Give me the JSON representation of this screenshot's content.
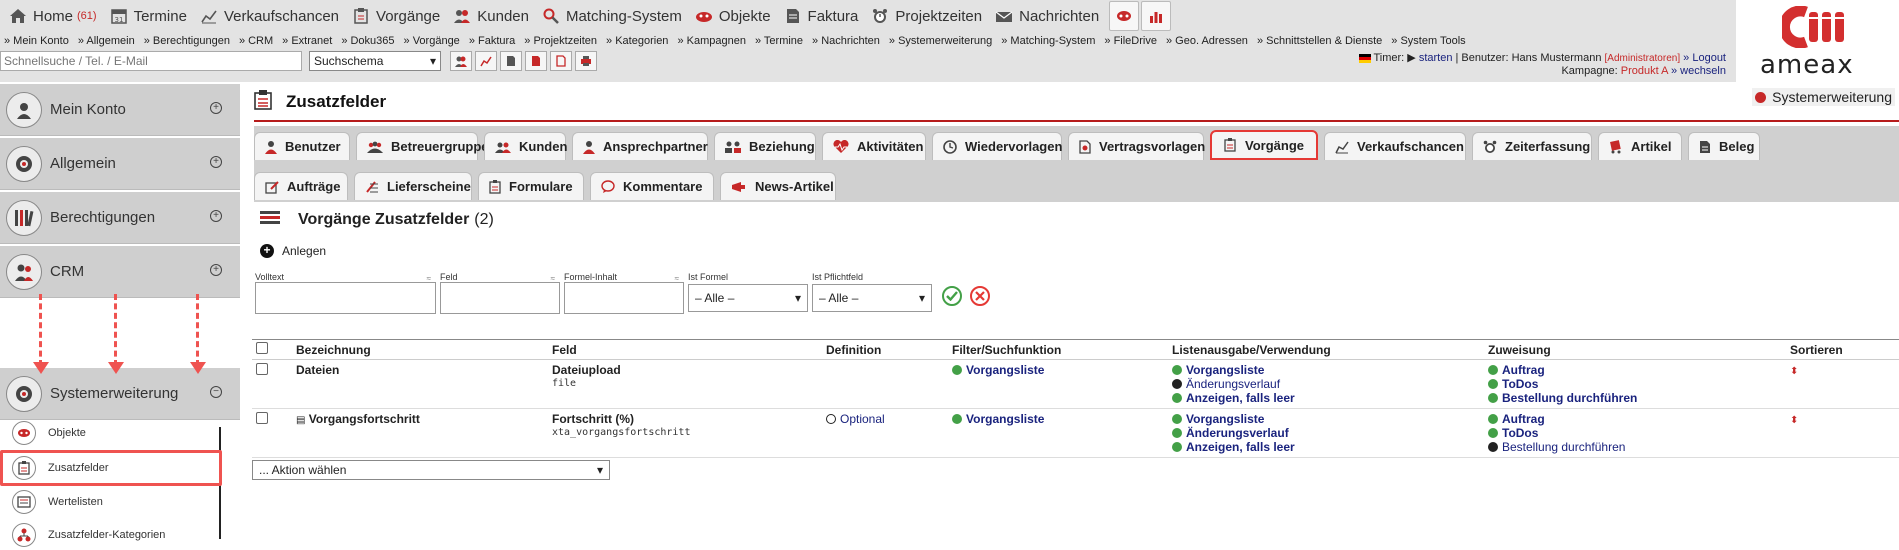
{
  "mainnav": {
    "items": [
      {
        "label": "Home",
        "badge": "(61)",
        "icon": "home-icon"
      },
      {
        "label": "Termine",
        "icon": "calendar-icon"
      },
      {
        "label": "Verkaufschancen",
        "icon": "chart-icon"
      },
      {
        "label": "Vorgänge",
        "icon": "clipboard-icon"
      },
      {
        "label": "Kunden",
        "icon": "users-icon"
      },
      {
        "label": "Matching-System",
        "icon": "search-icon"
      },
      {
        "label": "Objekte",
        "icon": "objects-icon"
      },
      {
        "label": "Faktura",
        "icon": "invoice-icon"
      },
      {
        "label": "Projektzeiten",
        "icon": "alarm-icon"
      },
      {
        "label": "Nachrichten",
        "icon": "mail-icon"
      }
    ]
  },
  "subnav": {
    "items": [
      "» Mein Konto",
      "» Allgemein",
      "» Berechtigungen",
      "» CRM",
      "» Extranet",
      "» Doku365",
      "» Vorgänge",
      "» Faktura",
      "» Projektzeiten",
      "» Kategorien",
      "» Kampagnen",
      "» Termine",
      "» Nachrichten",
      "» Systemerweiterung",
      "» Matching-System",
      "» FileDrive",
      "» Geo. Adressen",
      "» Schnittstellen & Dienste",
      "» System Tools"
    ]
  },
  "search": {
    "placeholder": "Schnellsuche / Tel. / E-Mail",
    "schema": "Suchschema"
  },
  "user": {
    "timer_label": "Timer:",
    "timer_start": "starten",
    "user_label": "| Benutzer:",
    "user_name": "Hans Mustermann",
    "role": "[Administratoren]",
    "logout": "» Logout",
    "campaign_label": "Kampagne:",
    "campaign": "Produkt A",
    "switch": "» wechseln"
  },
  "logo": {
    "text": "ameax"
  },
  "sidebar": {
    "sections": [
      {
        "label": "Mein Konto",
        "icon": "user-icon"
      },
      {
        "label": "Allgemein",
        "icon": "settings-icon"
      },
      {
        "label": "Berechtigungen",
        "icon": "books-icon"
      },
      {
        "label": "CRM",
        "icon": "users-icon"
      },
      {
        "label": "Systemerweiterung",
        "icon": "gear-icon"
      }
    ],
    "subitems": [
      {
        "label": "Objekte",
        "icon": "objects-icon"
      },
      {
        "label": "Zusatzfelder",
        "icon": "clipboard-icon"
      },
      {
        "label": "Wertelisten",
        "icon": "list-icon"
      },
      {
        "label": "Zusatzfelder-Kategorien",
        "icon": "hierarchy-icon"
      }
    ]
  },
  "page": {
    "title": "Zusatzfelder",
    "badge": "Systemerweiterung"
  },
  "tabs": {
    "row1": [
      "Benutzer",
      "Betreuergruppen",
      "Kunden",
      "Ansprechpartner",
      "Beziehung",
      "Aktivitäten",
      "Wiedervorlagen",
      "Vertragsvorlagen",
      "Vorgänge",
      "Verkaufschancen",
      "Zeiterfassung",
      "Artikel",
      "Beleg"
    ],
    "row2": [
      "Aufträge",
      "Lieferscheine",
      "Formulare",
      "Kommentare",
      "News-Artikel"
    ],
    "active": "Vorgänge"
  },
  "list": {
    "title": "Vorgänge Zusatzfelder",
    "count": "(2)",
    "create": "Anlegen"
  },
  "filters": {
    "volltext": "Volltext",
    "feld": "Feld",
    "formel_inhalt": "Formel-Inhalt",
    "ist_formel": "Ist Formel",
    "ist_pflichtfeld": "Ist Pflichtfeld",
    "all_option": "– Alle –",
    "sort_mark": "≈"
  },
  "table": {
    "headers": [
      "Bezeichnung",
      "Feld",
      "Definition",
      "Filter/Suchfunktion",
      "Listenausgabe/Verwendung",
      "Zuweisung",
      "Sortieren"
    ],
    "rows": [
      {
        "name": "Dateien",
        "field": "Dateiupload",
        "field_code": "file",
        "definition": "",
        "filter": "Vorgangsliste",
        "usage": [
          {
            "label": "Vorgangsliste",
            "state": "ok"
          },
          {
            "label": "Änderungsverlauf",
            "state": "no"
          },
          {
            "label": "Anzeigen, falls leer",
            "state": "ok"
          }
        ],
        "assign": [
          {
            "label": "Auftrag",
            "state": "ok"
          },
          {
            "label": "ToDos",
            "state": "ok"
          },
          {
            "label": "Bestellung durchführen",
            "state": "ok"
          }
        ]
      },
      {
        "name": "Vorgangsfortschritt",
        "field": "Fortschritt (%)",
        "field_code": "xta_vorgangsfortschritt",
        "definition": "Optional",
        "filter": "Vorgangsliste",
        "usage": [
          {
            "label": "Vorgangsliste",
            "state": "ok"
          },
          {
            "label": "Änderungsverlauf",
            "state": "ok"
          },
          {
            "label": "Anzeigen, falls leer",
            "state": "ok"
          }
        ],
        "assign": [
          {
            "label": "Auftrag",
            "state": "ok"
          },
          {
            "label": "ToDos",
            "state": "ok"
          },
          {
            "label": "Bestellung durchführen",
            "state": "no"
          }
        ]
      }
    ]
  },
  "action": {
    "placeholder": "... Aktion wählen"
  },
  "colors": {
    "accent": "#b71c1c",
    "annotation": "#ef5350",
    "ok": "#43a047",
    "link": "#1a237e"
  }
}
